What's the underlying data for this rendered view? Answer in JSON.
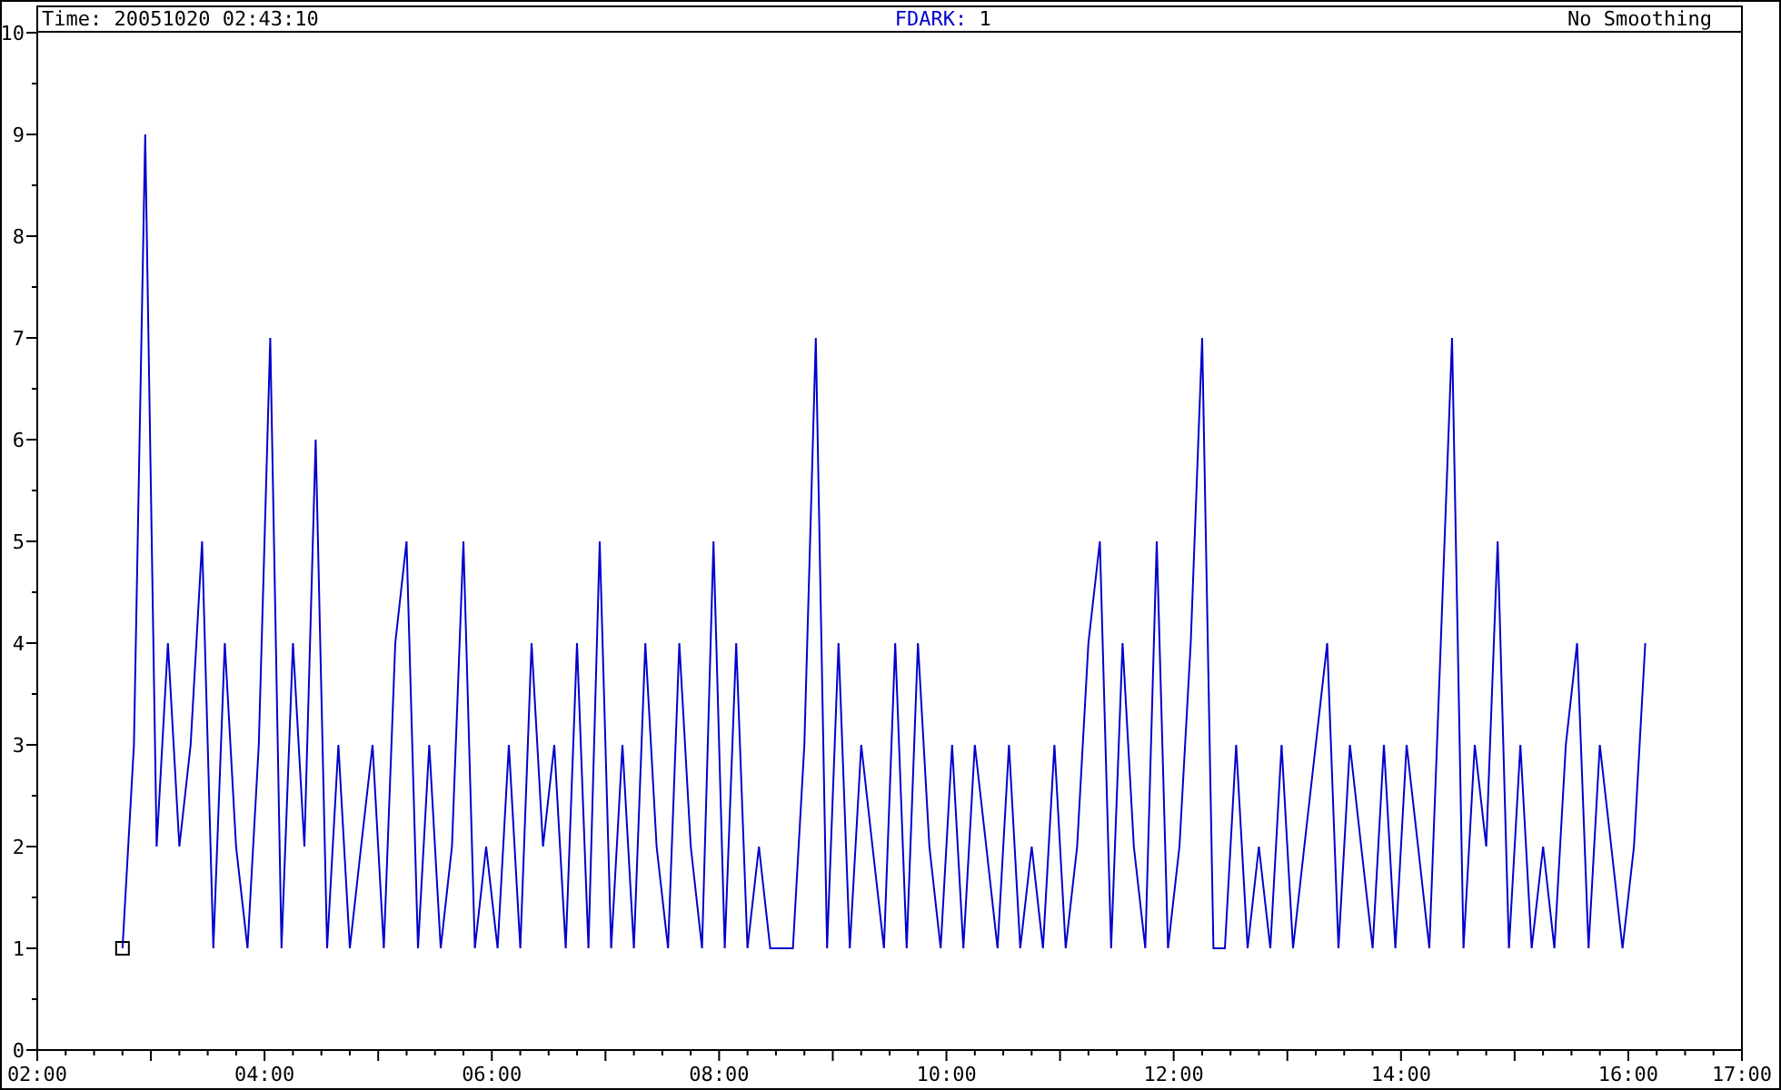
{
  "header": {
    "time_label": "Time: 20051020 02:43:10",
    "channel_label": "FDARK:",
    "channel_value": "1",
    "smoothing": "No Smoothing"
  },
  "chart_data": {
    "type": "line",
    "xlim": [
      2,
      17
    ],
    "ylim": [
      0,
      10
    ],
    "xticks": [
      {
        "value": 2,
        "label": "02:00"
      },
      {
        "value": 4,
        "label": "04:00"
      },
      {
        "value": 6,
        "label": "06:00"
      },
      {
        "value": 8,
        "label": "08:00"
      },
      {
        "value": 10,
        "label": "10:00"
      },
      {
        "value": 12,
        "label": "12:00"
      },
      {
        "value": 14,
        "label": "14:00"
      },
      {
        "value": 16,
        "label": "16:00"
      },
      {
        "value": 17,
        "label": "17:00"
      }
    ],
    "yticks": [
      {
        "value": 0,
        "label": "0"
      },
      {
        "value": 1,
        "label": "1"
      },
      {
        "value": 2,
        "label": "2"
      },
      {
        "value": 3,
        "label": "3"
      },
      {
        "value": 4,
        "label": "4"
      },
      {
        "value": 5,
        "label": "5"
      },
      {
        "value": 6,
        "label": "6"
      },
      {
        "value": 7,
        "label": "7"
      },
      {
        "value": 8,
        "label": "8"
      },
      {
        "value": 9,
        "label": "9"
      },
      {
        "value": 10,
        "label": "10"
      }
    ],
    "x": [
      2.75,
      2.85,
      2.95,
      3.05,
      3.15,
      3.25,
      3.35,
      3.45,
      3.55,
      3.65,
      3.75,
      3.85,
      3.95,
      4.05,
      4.15,
      4.25,
      4.35,
      4.45,
      4.55,
      4.65,
      4.75,
      4.85,
      4.95,
      5.05,
      5.15,
      5.25,
      5.35,
      5.45,
      5.55,
      5.65,
      5.75,
      5.85,
      5.95,
      6.05,
      6.15,
      6.25,
      6.35,
      6.45,
      6.55,
      6.65,
      6.75,
      6.85,
      6.95,
      7.05,
      7.15,
      7.25,
      7.35,
      7.45,
      7.55,
      7.65,
      7.75,
      7.85,
      7.95,
      8.05,
      8.15,
      8.25,
      8.35,
      8.45,
      8.55,
      8.65,
      8.75,
      8.85,
      8.95,
      9.05,
      9.15,
      9.25,
      9.35,
      9.45,
      9.55,
      9.65,
      9.75,
      9.85,
      9.95,
      10.05,
      10.15,
      10.25,
      10.35,
      10.45,
      10.55,
      10.65,
      10.75,
      10.85,
      10.95,
      11.05,
      11.15,
      11.25,
      11.35,
      11.45,
      11.55,
      11.65,
      11.75,
      11.85,
      11.95,
      12.05,
      12.15,
      12.25,
      12.35,
      12.45,
      12.55,
      12.65,
      12.75,
      12.85,
      12.95,
      13.05,
      13.15,
      13.25,
      13.35,
      13.45,
      13.55,
      13.65,
      13.75,
      13.85,
      13.95,
      14.05,
      14.15,
      14.25,
      14.35,
      14.45,
      14.55,
      14.65,
      14.75,
      14.85,
      14.95,
      15.05,
      15.15,
      15.25,
      15.35,
      15.45,
      15.55,
      15.65,
      15.75,
      15.85,
      15.95,
      16.05,
      16.15
    ],
    "series": [
      {
        "color": "#0000cc",
        "values": [
          1,
          3,
          9,
          2,
          4,
          2,
          3,
          5,
          1,
          4,
          2,
          1,
          3,
          7,
          1,
          4,
          2,
          6,
          1,
          3,
          1,
          2,
          3,
          1,
          4,
          5,
          1,
          3,
          1,
          2,
          5,
          1,
          2,
          1,
          3,
          1,
          4,
          2,
          3,
          1,
          4,
          1,
          5,
          1,
          3,
          1,
          4,
          2,
          1,
          4,
          2,
          1,
          5,
          1,
          4,
          1,
          2,
          1,
          1,
          1,
          3,
          7,
          1,
          4,
          1,
          3,
          2,
          1,
          4,
          1,
          4,
          2,
          1,
          3,
          1,
          3,
          2,
          1,
          3,
          1,
          2,
          1,
          3,
          1,
          2,
          4,
          5,
          1,
          4,
          2,
          1,
          5,
          1,
          2,
          4,
          7,
          1,
          1,
          3,
          1,
          2,
          1,
          3,
          1,
          2,
          3,
          4,
          1,
          3,
          2,
          1,
          3,
          1,
          3,
          2,
          1,
          4,
          7,
          1,
          3,
          2,
          5,
          1,
          3,
          1,
          2,
          1,
          3,
          4,
          1,
          3,
          2,
          1,
          2,
          4
        ]
      }
    ]
  }
}
